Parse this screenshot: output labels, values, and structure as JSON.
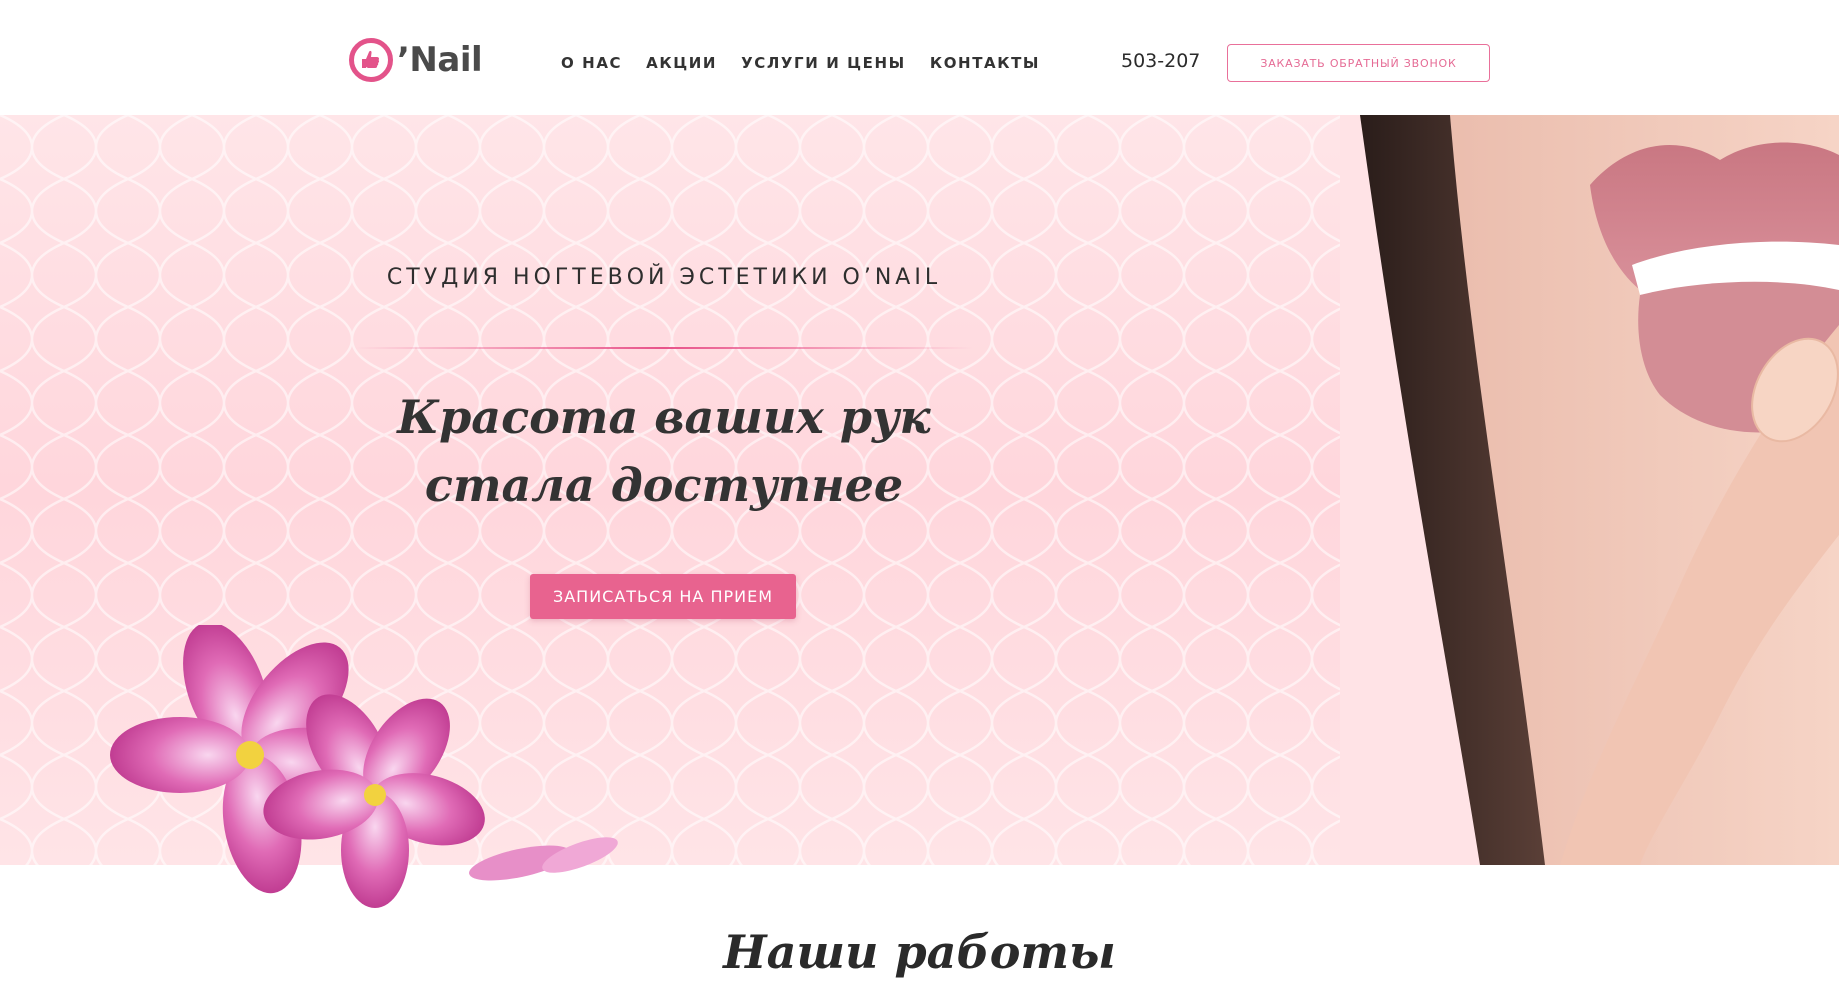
{
  "header": {
    "logo_text": "’Nail",
    "nav": [
      "О НАС",
      "АКЦИИ",
      "УСЛУГИ И ЦЕНЫ",
      "КОНТАКТЫ"
    ],
    "phone": "503-207",
    "callback_label": "ЗАКАЗАТЬ ОБРАТНЫЙ ЗВОНОК"
  },
  "hero": {
    "subtitle": "СТУДИЯ НОГТЕВОЙ ЭСТЕТИКИ O’NAIL",
    "title_line1": "Красота ваших рук",
    "title_line2": "стала доступнее",
    "cta_label": "ЗАПИСАТЬСЯ НА ПРИЕМ"
  },
  "works": {
    "title": "Наши работы"
  },
  "icons": {
    "logo": "thumbs-up-nail-icon"
  },
  "colors": {
    "accent": "#e8638f",
    "hero_bg": "#ffd9de",
    "text_dark": "#2b2b2b"
  }
}
